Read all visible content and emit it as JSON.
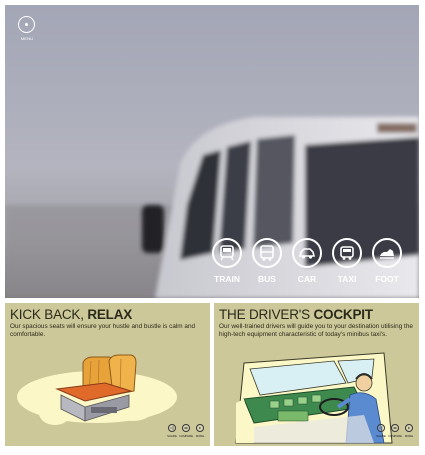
{
  "header": {
    "menu_label": "MENU"
  },
  "transport": [
    {
      "label": "TRAIN",
      "icon": "train-icon"
    },
    {
      "label": "BUS",
      "icon": "bus-icon"
    },
    {
      "label": "CAR",
      "icon": "car-icon"
    },
    {
      "label": "TAXI",
      "icon": "taxi-icon"
    },
    {
      "label": "FOOT",
      "icon": "foot-icon"
    }
  ],
  "cards": [
    {
      "title_light": "KICK BACK, ",
      "title_bold": "RELAX",
      "body": "Our spacious seats will ensure your hustle and bustle is calm and comfortable.",
      "actions": [
        "SHARE",
        "COMPARE",
        "MORE"
      ]
    },
    {
      "title_light": "THE DRIVER'S ",
      "title_bold": "COCKPIT",
      "body": "Our well-trained drivers will guide you to your destination utilising the high-tech equipment characteristic of today's minibus taxi's.",
      "actions": [
        "SHARE",
        "COMPARE",
        "MORE"
      ]
    }
  ],
  "colors": {
    "card_bg": "#cdc89a",
    "illustration_bg": "#fbf7c6",
    "seat_orange": "#e8a23a",
    "cockpit_green": "#3e8a4e",
    "icon_white": "#ffffff"
  }
}
